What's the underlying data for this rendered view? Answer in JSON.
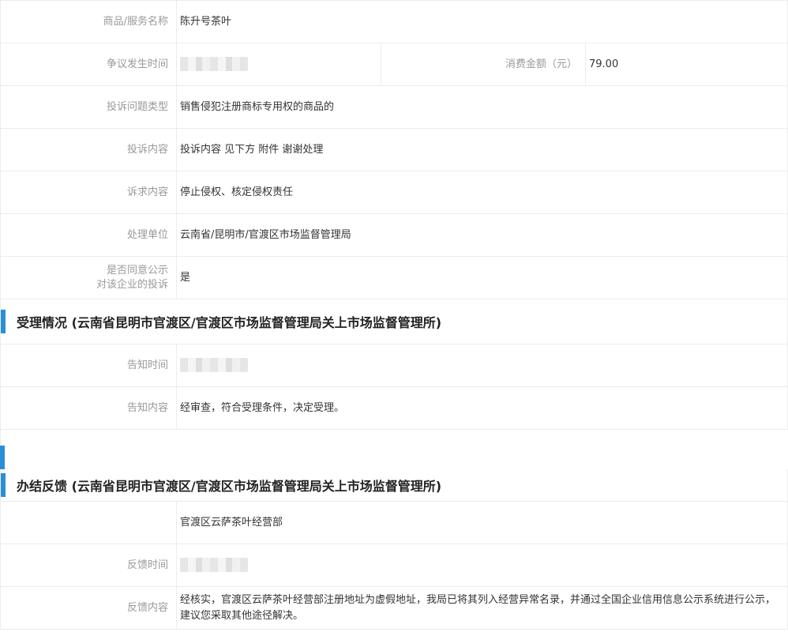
{
  "complaint": {
    "rows": [
      {
        "label": "商品/服务名称",
        "value": "陈升号茶叶"
      },
      {
        "label": "争议发生时间",
        "value": ""
      },
      {
        "label": "投诉问题类型",
        "value": "销售侵犯注册商标专用权的商品的"
      },
      {
        "label": "投诉内容",
        "value": "投诉内容 见下方 附件 谢谢处理"
      },
      {
        "label": "诉求内容",
        "value": "停止侵权、核定侵权责任"
      },
      {
        "label": "处理单位",
        "value": "云南省/昆明市/官渡区市场监督管理局"
      },
      {
        "label_line1": "是否同意公示",
        "label_line2": "对该企业的投诉",
        "value": "是"
      }
    ],
    "amount_label": "消费金额（元）",
    "amount_value": "79.00"
  },
  "acceptance": {
    "title": "受理情况 (云南省昆明市官渡区/官渡区市场监督管理局关上市场监督管理所)",
    "rows": [
      {
        "label": "告知时间",
        "value": ""
      },
      {
        "label": "告知内容",
        "value": "经审查，符合受理条件，决定受理。"
      }
    ]
  },
  "feedback": {
    "title": "办结反馈 (云南省昆明市官渡区/官渡区市场监督管理局关上市场监督管理所)",
    "rows": [
      {
        "label": "",
        "value": "官渡区云萨茶叶经营部"
      },
      {
        "label": "反馈时间",
        "value": ""
      },
      {
        "label": "反馈内容",
        "value": "经核实，官渡区云萨茶叶经营部注册地址为虚假地址，我局已将其列入经营异常名录，并通过全国企业信用信息公示系统进行公示，建议您采取其他途径解决。"
      }
    ]
  },
  "colors": {
    "accent": "#2a8fd6",
    "label": "#999999",
    "border": "#ececec"
  }
}
